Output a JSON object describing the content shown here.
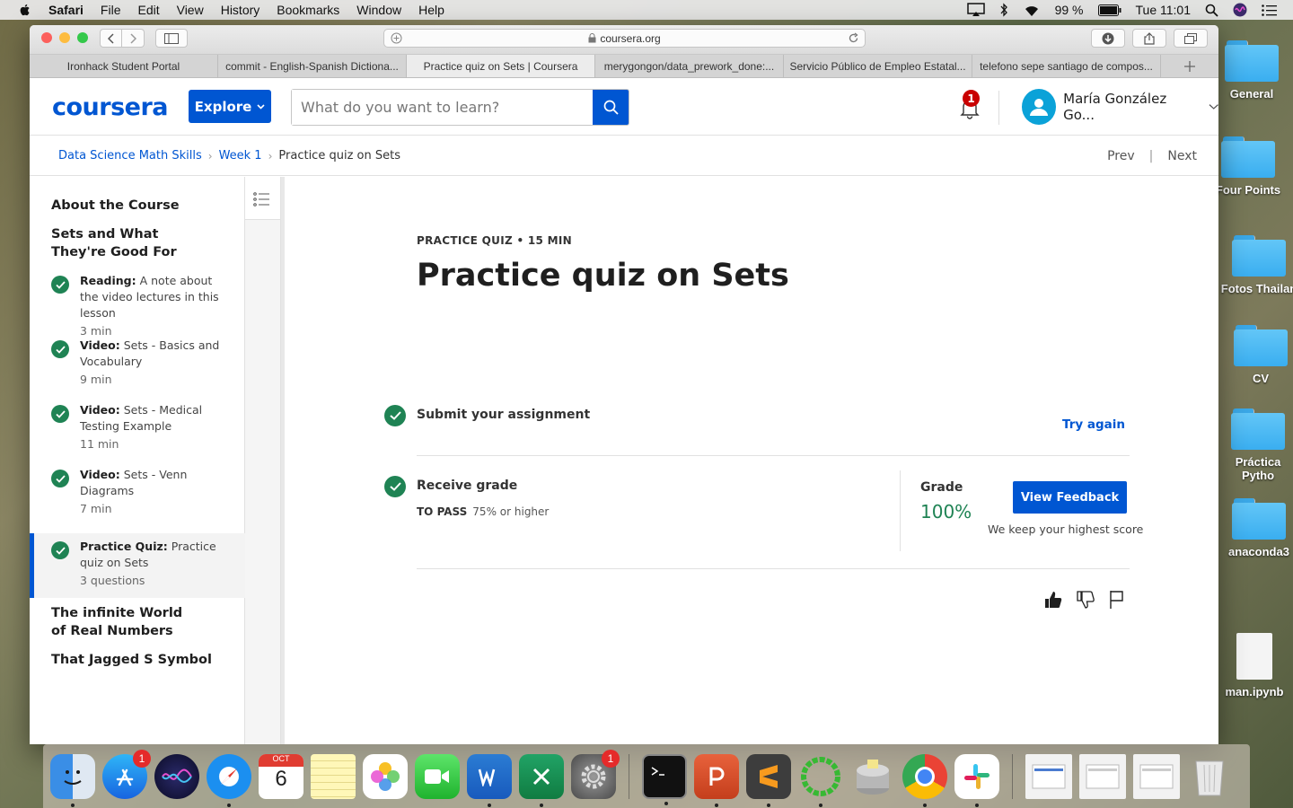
{
  "menubar": {
    "app": "Safari",
    "items": [
      "File",
      "Edit",
      "View",
      "History",
      "Bookmarks",
      "Window",
      "Help"
    ],
    "battery": "99 %",
    "clock": "Tue 11:01"
  },
  "desktop": {
    "icons": [
      "General",
      "Four Points",
      "Fotos Thailan",
      "CV",
      "Práctica Pytho",
      "anaconda3",
      "man.ipynb"
    ]
  },
  "browser": {
    "url": "coursera.org",
    "tabs": [
      "Ironhack Student Portal",
      "commit - English-Spanish Dictiona...",
      "Practice quiz on Sets | Coursera",
      "merygongon/data_prework_done:...",
      "Servicio Público de Empleo Estatal...",
      "telefono sepe santiago de compos..."
    ],
    "active_tab": 2
  },
  "header": {
    "logo": "coursera",
    "explore_label": "Explore",
    "search_placeholder": "What do you want to learn?",
    "notifications_count": "1",
    "user_name": "María González Go..."
  },
  "breadcrumb": {
    "items": [
      "Data Science Math Skills",
      "Week 1",
      "Practice quiz on Sets"
    ],
    "prev": "Prev",
    "next": "Next"
  },
  "sidebar": {
    "sections": [
      "About the Course",
      "Sets and What They're Good For",
      "The infinite World of Real Numbers",
      "That Jagged S Symbol"
    ],
    "items": [
      {
        "type": "Reading:",
        "title": "A note about the video lectures in this lesson",
        "meta": "3 min"
      },
      {
        "type": "Video:",
        "title": "Sets - Basics and Vocabulary",
        "meta": "9 min"
      },
      {
        "type": "Video:",
        "title": "Sets - Medical Testing Example",
        "meta": "11 min"
      },
      {
        "type": "Video:",
        "title": "Sets - Venn Diagrams",
        "meta": "7 min"
      },
      {
        "type": "Practice Quiz:",
        "title": "Practice quiz on Sets",
        "meta": "3 questions"
      }
    ]
  },
  "quiz": {
    "eyebrow": "PRACTICE QUIZ • 15 MIN",
    "title": "Practice quiz on Sets",
    "submit_label": "Submit your assignment",
    "try_again": "Try again",
    "receive_label": "Receive grade",
    "to_pass_label": "TO PASS",
    "to_pass_value": "75% or higher",
    "grade_label": "Grade",
    "grade_value": "100%",
    "feedback_button": "View Feedback",
    "keep_note": "We keep your highest score"
  },
  "dock": {
    "appstore_badge": "1",
    "settings_badge": "1",
    "calendar_month": "OCT",
    "calendar_day": "6"
  },
  "colors": {
    "brand": "#0056d2",
    "success": "#1f8354",
    "badge": "#c90000"
  }
}
